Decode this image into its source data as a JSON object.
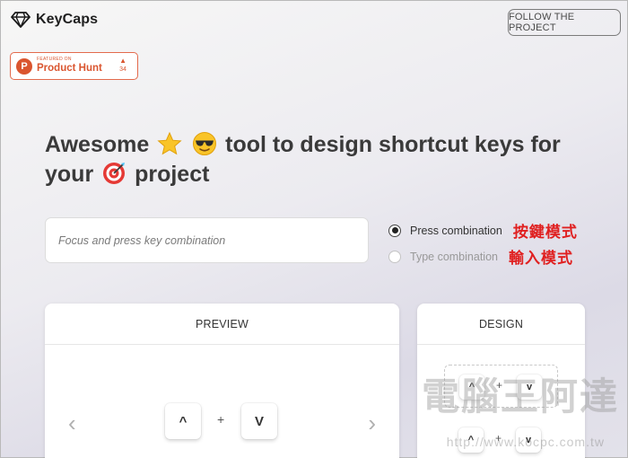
{
  "header": {
    "logo_text": "KeyCaps",
    "follow_button": "FOLLOW THE PROJECT"
  },
  "product_hunt": {
    "featured_on": "FEATURED ON",
    "name": "Product Hunt",
    "arrow": "▲",
    "votes": "34"
  },
  "headline": {
    "part1": "Awesome",
    "part2": "tool to design shortcut keys for",
    "part3": "your",
    "part4": "project"
  },
  "input": {
    "placeholder": "Focus and press key combination",
    "value": ""
  },
  "modes": [
    {
      "label": "Press combination",
      "selected": true,
      "annotation": "按鍵模式"
    },
    {
      "label": "Type combination",
      "selected": false,
      "annotation": "輸入模式"
    }
  ],
  "preview": {
    "title": "PREVIEW",
    "prev_arrow": "‹",
    "next_arrow": "›",
    "keys": [
      "^",
      "V"
    ],
    "separator": "+"
  },
  "design": {
    "title": "DESIGN",
    "keys": [
      "^",
      "v"
    ],
    "separator": "+",
    "keys2": [
      "^",
      "v"
    ]
  },
  "watermark": {
    "text": "電腦王阿達",
    "url": "http://www.kocpc.com.tw"
  },
  "colors": {
    "accent": "#da552f",
    "annotation": "#e02020"
  }
}
